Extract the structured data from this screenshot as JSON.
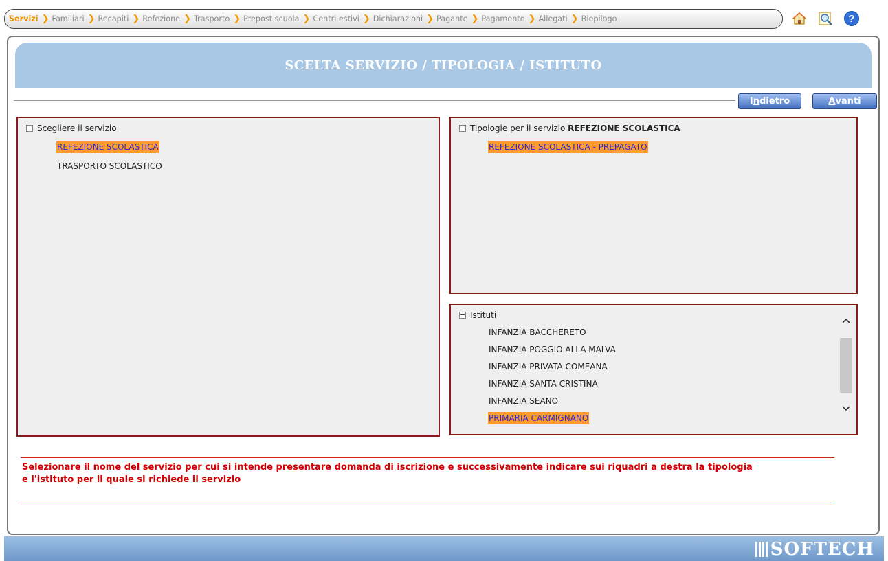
{
  "breadcrumb": {
    "steps": [
      "Servizi",
      "Familiari",
      "Recapiti",
      "Refezione",
      "Trasporto",
      "Prepost scuola",
      "Centri estivi",
      "Dichiarazioni",
      "Pagante",
      "Pagamento",
      "Allegati",
      "Riepilogo"
    ],
    "active_index": 0
  },
  "header_icons": [
    "home-icon",
    "preview-icon",
    "help-icon"
  ],
  "page_title": "SCELTA SERVIZIO / TIPOLOGIA / ISTITUTO",
  "buttons": {
    "back": {
      "first": "I",
      "underline": "n",
      "rest": "dietro"
    },
    "next": {
      "first": "",
      "underline": "A",
      "rest": "vanti"
    }
  },
  "servizi": {
    "header": "Scegliere il servizio",
    "items": [
      {
        "label": "REFEZIONE SCOLASTICA",
        "selected": true
      },
      {
        "label": "TRASPORTO SCOLASTICO",
        "selected": false
      }
    ]
  },
  "tipologie": {
    "header_prefix": "Tipologie per il servizio",
    "header_service": "REFEZIONE SCOLASTICA",
    "items": [
      {
        "label": "REFEZIONE SCOLASTICA - PREPAGATO",
        "selected": true
      }
    ]
  },
  "istituti": {
    "header": "Istituti",
    "items": [
      {
        "label": "INFANZIA BACCHERETO",
        "selected": false
      },
      {
        "label": "INFANZIA POGGIO ALLA MALVA",
        "selected": false
      },
      {
        "label": "INFANZIA PRIVATA COMEANA",
        "selected": false
      },
      {
        "label": "INFANZIA SANTA CRISTINA",
        "selected": false
      },
      {
        "label": "INFANZIA SEANO",
        "selected": false
      },
      {
        "label": "PRIMARIA CARMIGNANO",
        "selected": true
      }
    ]
  },
  "instructions": {
    "line1": "Selezionare il nome del servizio per cui si intende presentare domanda di iscrizione e successivamente indicare sui riquadri a destra la tipologia",
    "line2": "e l'istituto per il quale si richiede il servizio"
  },
  "footer_logo": "SOFTECH",
  "colors": {
    "selection": "#ff9a2e",
    "selected_text": "#2a2ad8",
    "box_border": "#8b1a1a",
    "title_bg": "#a8c8e6",
    "message": "#d20000"
  }
}
